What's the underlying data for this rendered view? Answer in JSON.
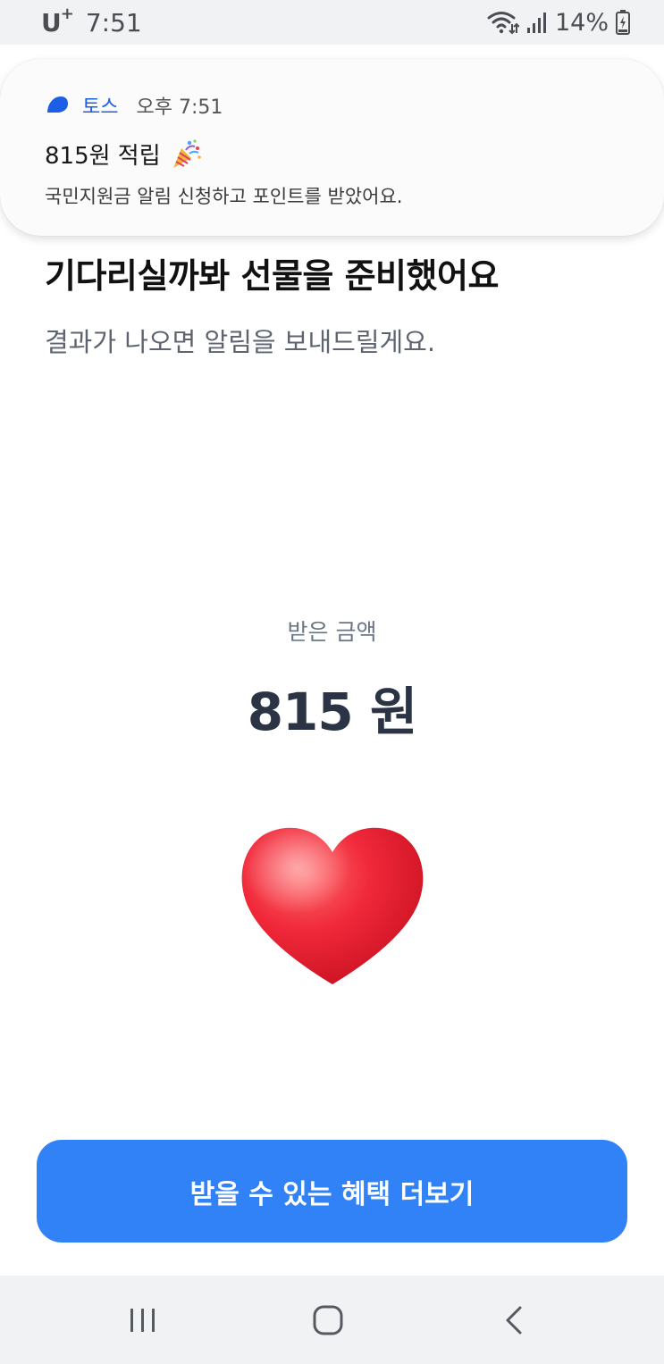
{
  "status_bar": {
    "carrier": "U",
    "carrier_sup": "+",
    "time": "7:51",
    "battery": "14%",
    "icons": [
      "wifi-icon",
      "signal-icon",
      "battery-charging-icon"
    ]
  },
  "notification": {
    "app_name": "토스",
    "time": "오후 7:51",
    "title": "815원 적립",
    "body": "국민지원금 알림 신청하고 포인트를 받았어요.",
    "icons": [
      "toss-logo-icon",
      "party-popper-icon"
    ],
    "accent_color": "#1c5fe6"
  },
  "main": {
    "headline": "기다리실까봐 선물을 준비했어요",
    "subline": "결과가 나오면 알림을 보내드릴게요.",
    "amount_label": "받은 금액",
    "amount": "815 원",
    "illustration": "heart-icon"
  },
  "cta": {
    "label": "받을 수 있는 혜택 더보기",
    "color": "#3182f6"
  },
  "nav_bar": {
    "icons": [
      "recent-apps-icon",
      "home-icon",
      "back-icon"
    ]
  }
}
